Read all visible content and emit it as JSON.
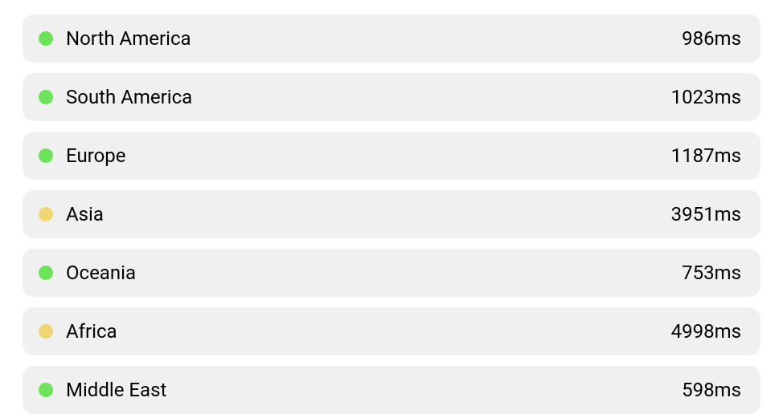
{
  "status_colors": {
    "good": "#6de35a",
    "warn": "#f0d773"
  },
  "regions": [
    {
      "name": "North America",
      "latency": "986ms",
      "status": "good"
    },
    {
      "name": "South America",
      "latency": "1023ms",
      "status": "good"
    },
    {
      "name": "Europe",
      "latency": "1187ms",
      "status": "good"
    },
    {
      "name": "Asia",
      "latency": "3951ms",
      "status": "warn"
    },
    {
      "name": "Oceania",
      "latency": "753ms",
      "status": "good"
    },
    {
      "name": "Africa",
      "latency": "4998ms",
      "status": "warn"
    },
    {
      "name": "Middle East",
      "latency": "598ms",
      "status": "good"
    }
  ]
}
